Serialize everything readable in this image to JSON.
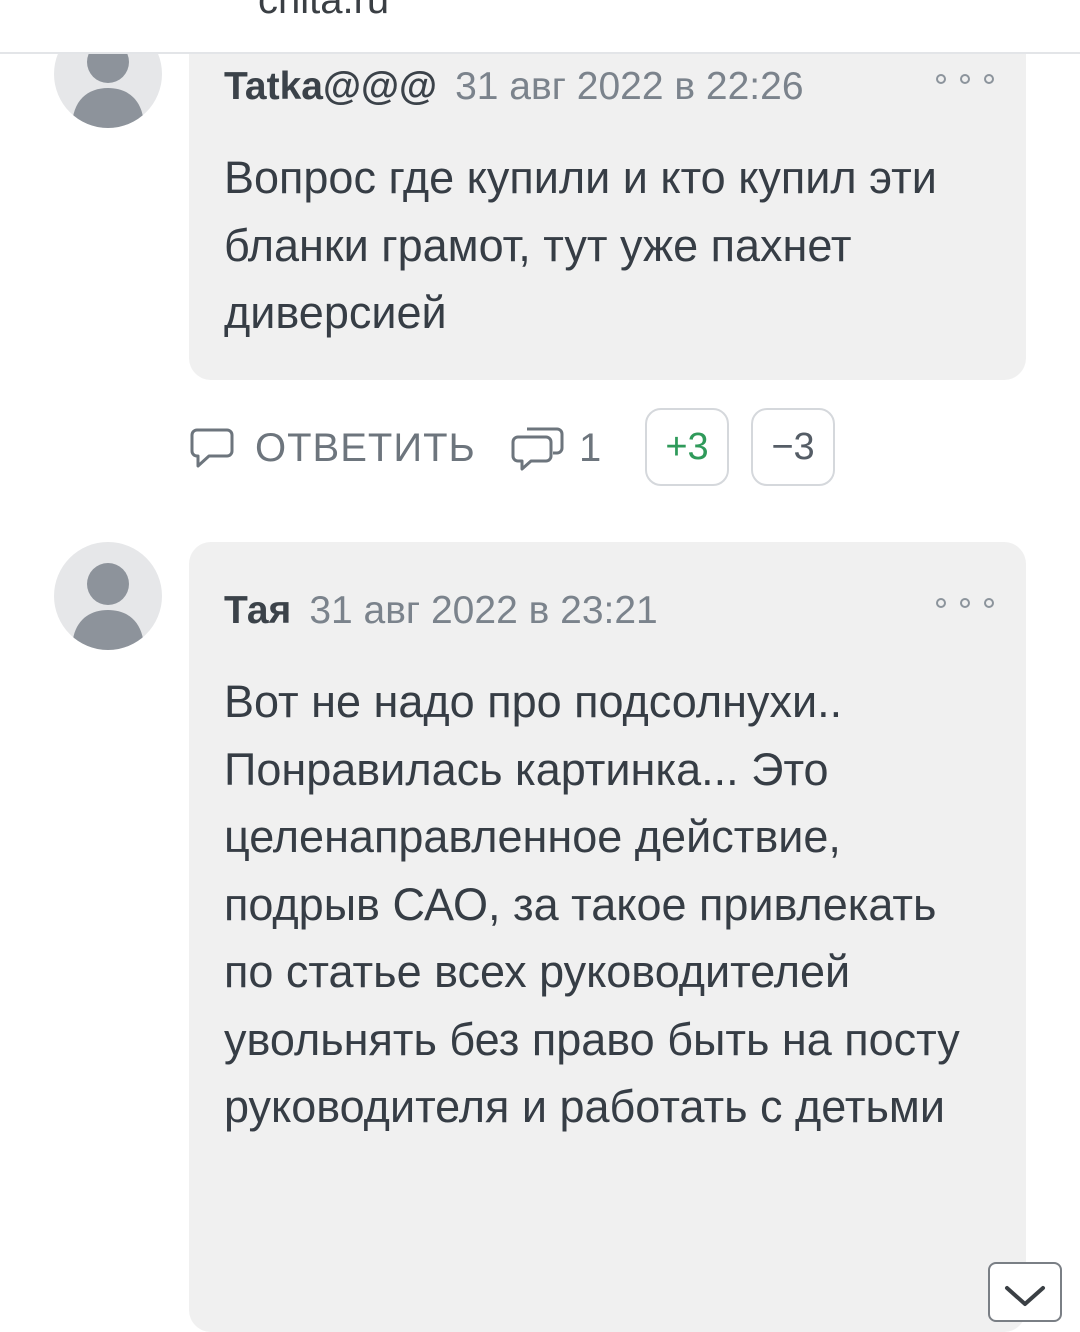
{
  "site": {
    "url": "chita.ru"
  },
  "comments": [
    {
      "author": "Tatka@@@",
      "date": "31 авг 2022 в 22:26",
      "text": "Вопрос где купили и кто купил эти бланки грамот, тут уже пахнет диверсией"
    },
    {
      "author": "Тая",
      "date": "31 авг 2022 в 23:21",
      "text": "Вот не надо про подсолнухи.. Понравилась картинка... Это целенаправленное действие, подрыв САО, за такое привлекать по статье всех руководителей увольнять без право быть на посту руководителя и работать с детьми"
    }
  ],
  "actions": {
    "reply_label": "ОТВЕТИТЬ",
    "replies_count": "1",
    "vote_up": "+3",
    "vote_down": "−3"
  },
  "icons": {
    "avatar": "user-silhouette-icon",
    "more": "more-options-icon",
    "reply": "speech-bubble-icon",
    "replies": "replies-bubble-icon",
    "scroll": "chevron-down-icon"
  },
  "colors": {
    "bubble": "#f0f0f0",
    "vote_up": "#2f9a5a",
    "muted": "#7b838c"
  }
}
